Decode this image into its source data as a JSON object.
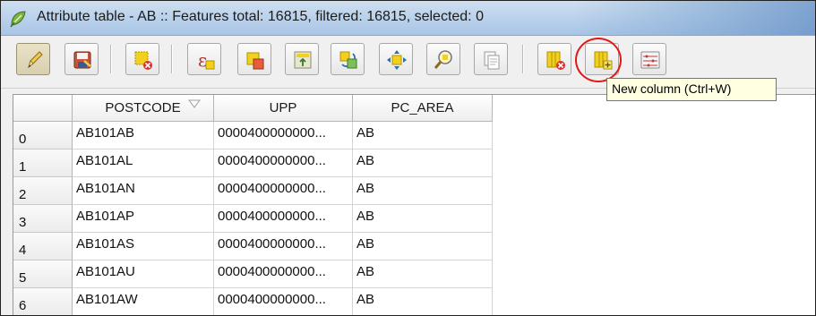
{
  "window": {
    "title": "Attribute table - AB :: Features total: 16815, filtered: 16815, selected: 0",
    "app_icon": "qgis-leaf-icon"
  },
  "toolbar": {
    "buttons": [
      {
        "name": "toggle-editing",
        "icon": "pencil-icon",
        "active": true
      },
      {
        "name": "save-edits",
        "icon": "save-edits-icon"
      },
      {
        "name": "delete-selected",
        "icon": "delete-selected-features-icon"
      },
      {
        "name": "select-by-expression",
        "icon": "expression-epsilon-icon"
      },
      {
        "name": "unselect-all",
        "icon": "unselect-all-icon"
      },
      {
        "name": "move-selection-to-top",
        "icon": "move-selection-top-icon"
      },
      {
        "name": "invert-selection",
        "icon": "invert-selection-icon"
      },
      {
        "name": "pan-map-to-selected",
        "icon": "pan-to-selected-icon"
      },
      {
        "name": "zoom-map-to-selected",
        "icon": "zoom-to-selected-icon"
      },
      {
        "name": "copy-selected-rows",
        "icon": "copy-rows-icon"
      },
      {
        "name": "delete-column",
        "icon": "delete-column-icon"
      },
      {
        "name": "new-column",
        "icon": "new-column-icon"
      },
      {
        "name": "field-calculator",
        "icon": "field-calculator-icon"
      }
    ],
    "tooltip": "New column (Ctrl+W)",
    "highlight_color": "#e01919"
  },
  "table": {
    "columns": [
      "POSTCODE",
      "UPP",
      "PC_AREA"
    ],
    "rows": [
      {
        "index": "0",
        "POSTCODE": "AB101AB",
        "UPP": "0000400000000...",
        "PC_AREA": "AB"
      },
      {
        "index": "1",
        "POSTCODE": "AB101AL",
        "UPP": "0000400000000...",
        "PC_AREA": "AB"
      },
      {
        "index": "2",
        "POSTCODE": "AB101AN",
        "UPP": "0000400000000...",
        "PC_AREA": "AB"
      },
      {
        "index": "3",
        "POSTCODE": "AB101AP",
        "UPP": "0000400000000...",
        "PC_AREA": "AB"
      },
      {
        "index": "4",
        "POSTCODE": "AB101AS",
        "UPP": "0000400000000...",
        "PC_AREA": "AB"
      },
      {
        "index": "5",
        "POSTCODE": "AB101AU",
        "UPP": "0000400000000...",
        "PC_AREA": "AB"
      },
      {
        "index": "6",
        "POSTCODE": "AB101AW",
        "UPP": "0000400000000...",
        "PC_AREA": "AB"
      }
    ]
  }
}
